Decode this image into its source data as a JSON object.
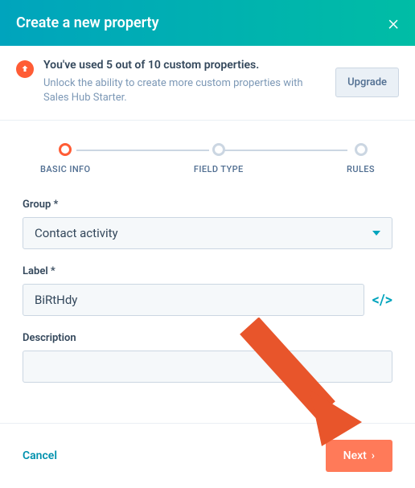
{
  "header": {
    "title": "Create a new property"
  },
  "banner": {
    "title": "You've used 5 out of 10 custom properties.",
    "subtitle": "Unlock the ability to create more custom properties with Sales Hub Starter.",
    "upgrade": "Upgrade"
  },
  "stepper": {
    "steps": [
      "BASIC INFO",
      "FIELD TYPE",
      "RULES"
    ],
    "active": 0
  },
  "form": {
    "group_label": "Group *",
    "group_value": "Contact activity",
    "label_label": "Label *",
    "label_value": "BiRtHdy",
    "description_label": "Description",
    "description_value": ""
  },
  "footer": {
    "cancel": "Cancel",
    "next": "Next"
  }
}
